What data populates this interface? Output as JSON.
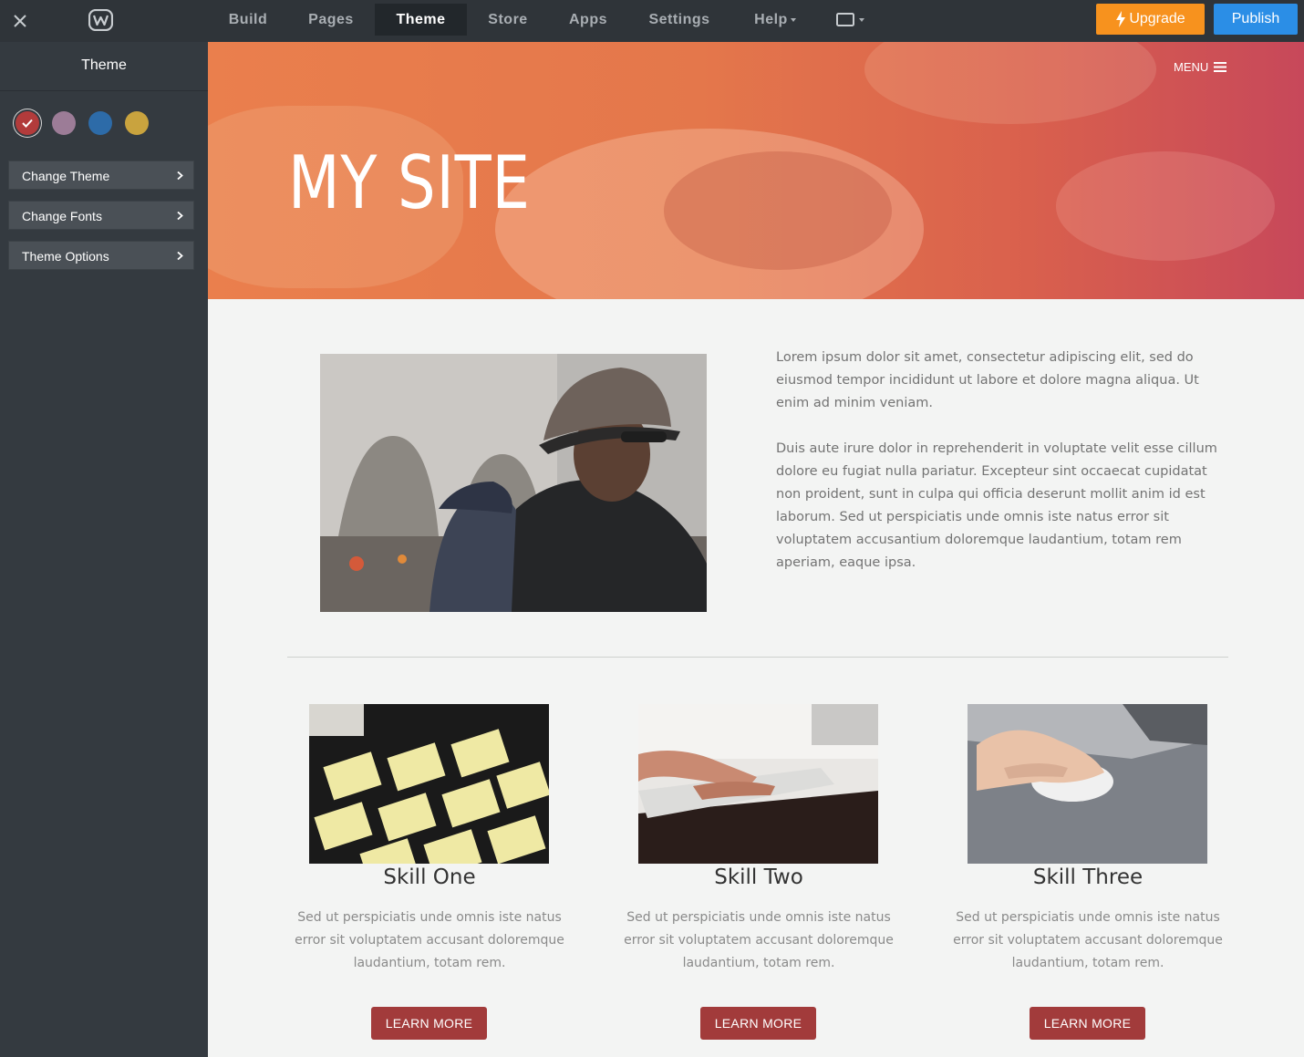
{
  "topbar": {
    "tabs": [
      {
        "label": "Build",
        "active": false
      },
      {
        "label": "Pages",
        "active": false
      },
      {
        "label": "Theme",
        "active": true
      },
      {
        "label": "Store",
        "active": false
      },
      {
        "label": "Apps",
        "active": false
      },
      {
        "label": "Settings",
        "active": false
      },
      {
        "label": "Help",
        "active": false
      }
    ],
    "upgrade_label": "Upgrade",
    "publish_label": "Publish",
    "colors": {
      "bar": "#2f3439",
      "upgrade": "#f7921e",
      "publish": "#2b8ee6"
    }
  },
  "sidebar": {
    "title": "Theme",
    "swatches": [
      {
        "color": "#b23b3b",
        "selected": true
      },
      {
        "color": "#9c7c97",
        "selected": false
      },
      {
        "color": "#2d6ba8",
        "selected": false
      },
      {
        "color": "#c9a33e",
        "selected": false
      }
    ],
    "buttons": [
      {
        "label": "Change Theme"
      },
      {
        "label": "Change Fonts"
      },
      {
        "label": "Theme Options"
      }
    ]
  },
  "site": {
    "title": "MY SITE",
    "menu_label": "MENU",
    "about": {
      "paragraph_1": "Lorem ipsum dolor sit amet, consectetur adipiscing elit, sed do eiusmod tempor incididunt ut labore et dolore magna aliqua. Ut enim ad minim veniam.",
      "paragraph_2": "Duis aute irure dolor in reprehenderit in voluptate velit esse cillum dolore eu fugiat nulla pariatur. Excepteur sint occaecat cupidatat non proident, sunt in culpa qui officia deserunt mollit anim id est laborum. Sed ut perspiciatis unde omnis iste natus error sit voluptatem accusantium doloremque laudantium, totam rem aperiam, eaque ipsa."
    },
    "skills": [
      {
        "title": "Skill One",
        "description": "Sed ut perspiciatis unde omnis iste natus error sit voluptatem accusant doloremque laudantium, totam rem.",
        "button": "LEARN MORE"
      },
      {
        "title": "Skill Two",
        "description": "Sed ut perspiciatis unde omnis iste natus error sit voluptatem accusant doloremque laudantium, totam rem.",
        "button": "LEARN MORE"
      },
      {
        "title": "Skill Three",
        "description": "Sed ut perspiciatis unde omnis iste natus error sit voluptatem accusant doloremque laudantium, totam rem.",
        "button": "LEARN MORE"
      }
    ],
    "accent_color": "#a23b3b"
  }
}
